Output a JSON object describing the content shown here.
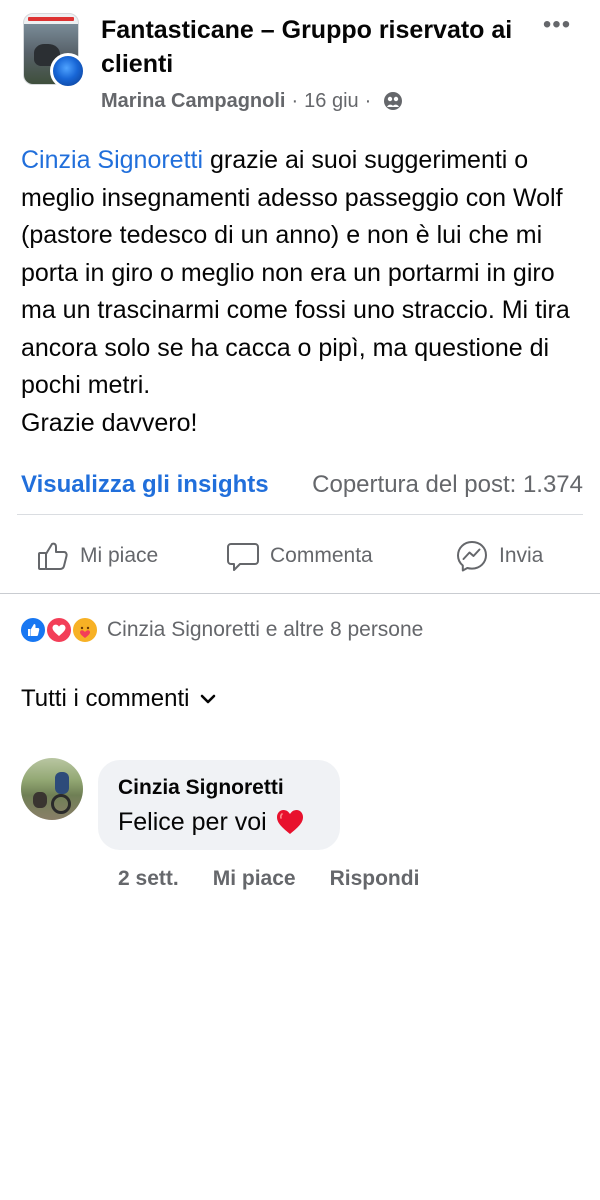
{
  "post": {
    "group_name": "Fantasticane – Gruppo riservato ai clienti",
    "author": "Marina Campagnoli",
    "separator": "·",
    "date": "16 giu",
    "mention": "Cinzia Signoretti",
    "body_lines": [
      " grazie ai suoi suggerimenti o meglio insegnamenti adesso passeggio con Wolf (pastore tedesco di un anno) e non è lui che mi porta in giro o meglio non era un portarmi in giro ma un trascinarmi come fossi uno straccio. Mi tira ancora solo se ha cacca o pipì, ma questione di pochi metri.",
      "Grazie davvero!"
    ],
    "insights_label": "Visualizza gli insights",
    "reach_label": "Copertura del post: 1.374"
  },
  "actions": {
    "like": "Mi piace",
    "comment": "Commenta",
    "share": "Invia"
  },
  "reactions": {
    "summary": "Cinzia Signoretti e altre 8 persone",
    "types": [
      "like-icon",
      "love-icon",
      "care-icon"
    ],
    "colors": {
      "like": "#1877f2",
      "love": "#f33e58",
      "care": "#f7b125"
    }
  },
  "comments_filter": "Tutti i commenti",
  "comments": [
    {
      "author": "Cinzia Signoretti",
      "text": "Felice per voi",
      "time": "2 sett.",
      "like_label": "Mi piace",
      "reply_label": "Rispondi"
    }
  ],
  "colors": {
    "link": "#216fdb",
    "secondary_text": "#65676b",
    "bubble": "#f0f2f5"
  }
}
